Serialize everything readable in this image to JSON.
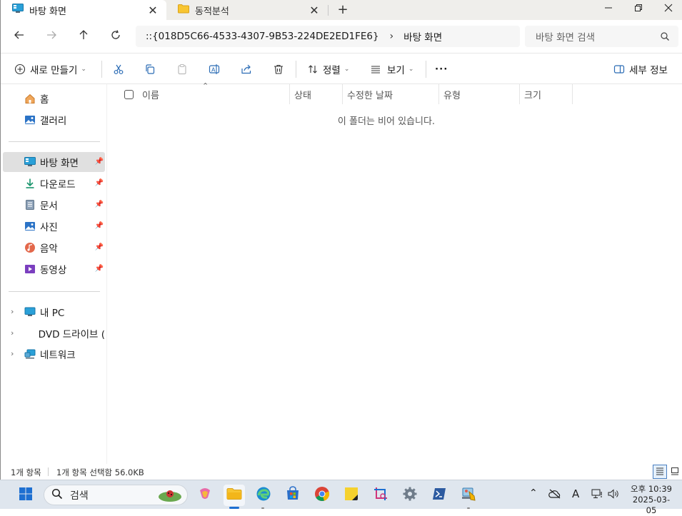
{
  "tabs": [
    {
      "label": "바탕 화면",
      "close": "✕"
    },
    {
      "label": "동적분석",
      "close": "✕"
    }
  ],
  "new_tab": "+",
  "window_controls": {
    "minimize": "minimize-icon",
    "maximize": "maximize-icon",
    "close": "close-icon"
  },
  "address": {
    "path": "::{018D5C66-4533-4307-9B53-224DE2ED1FE6}",
    "separator": "›",
    "current": "바탕 화면"
  },
  "search": {
    "placeholder": "바탕 화면 검색"
  },
  "toolbar": {
    "new_label": "새로 만들기",
    "sort_label": "정렬",
    "view_label": "보기",
    "more_label": "···",
    "details_label": "세부 정보"
  },
  "sidebar": {
    "quick": [
      {
        "label": "홈",
        "icon": "home-icon"
      },
      {
        "label": "갤러리",
        "icon": "gallery-icon"
      }
    ],
    "pinned": [
      {
        "label": "바탕 화면",
        "icon": "desktop-icon",
        "selected": true
      },
      {
        "label": "다운로드",
        "icon": "download-icon"
      },
      {
        "label": "문서",
        "icon": "document-icon"
      },
      {
        "label": "사진",
        "icon": "pictures-icon"
      },
      {
        "label": "음악",
        "icon": "music-icon"
      },
      {
        "label": "동영상",
        "icon": "video-icon"
      }
    ],
    "devices": [
      {
        "label": "내 PC",
        "icon": "pc-icon"
      },
      {
        "label": "DVD 드라이브 (",
        "icon": "dvd-icon"
      },
      {
        "label": "네트워크",
        "icon": "network-icon"
      }
    ]
  },
  "columns": [
    {
      "label": "이름"
    },
    {
      "label": "상태"
    },
    {
      "label": "수정한 날짜"
    },
    {
      "label": "유형"
    },
    {
      "label": "크기"
    }
  ],
  "empty_message": "이 폴더는 비어 있습니다.",
  "status": {
    "items": "1개 항목",
    "selected": "1개 항목 선택함 56.0KB"
  },
  "taskbar": {
    "search_label": "검색",
    "clock_time": "오후 10:39",
    "clock_date": "2025-03-05",
    "ime": "A"
  },
  "colors": {
    "accent": "#1d6fd1",
    "selected_bg": "#e0e0e0",
    "tab_bar_bg": "#efeeeb",
    "taskbar_bg": "#dfe6ee"
  }
}
